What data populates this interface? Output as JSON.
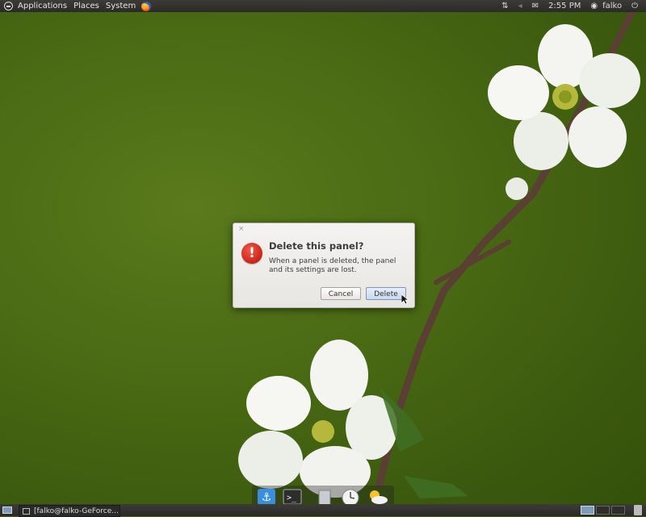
{
  "top_panel": {
    "menus": [
      "Applications",
      "Places",
      "System"
    ],
    "time": "2:55 PM",
    "user": "falko"
  },
  "dialog": {
    "title": "Delete this panel?",
    "message": "When a panel is deleted, the panel and its settings are lost.",
    "cancel_label": "Cancel",
    "delete_label": "Delete",
    "close_glyph": "×",
    "icon_glyph": "!"
  },
  "taskbar": {
    "window_title": "[falko@falko-GeForce..."
  },
  "dock": {
    "items": [
      "anchor-icon",
      "terminal-icon",
      "trash-icon",
      "clock-icon",
      "weather-icon"
    ]
  },
  "colors": {
    "accent": "#d22a1e",
    "panel": "#2b2a27",
    "wallpaper": "#4a6a14"
  }
}
